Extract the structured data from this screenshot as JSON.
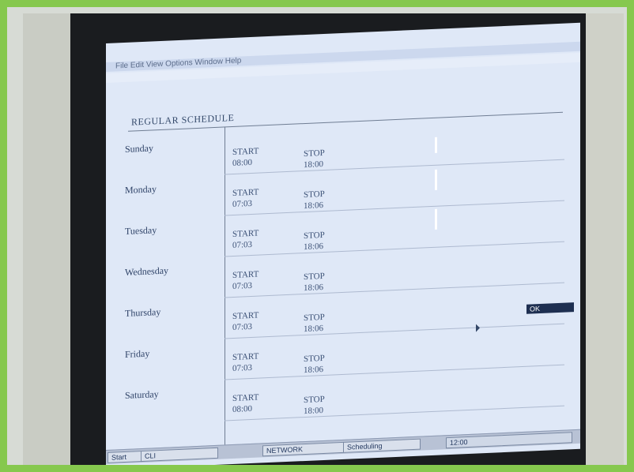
{
  "window": {
    "title": "REGULAR SCHEDULE",
    "menu_text": "File  Edit  View  Options  Window  Help"
  },
  "schedule": [
    {
      "day": "Sunday",
      "start_label": "START",
      "start": "08:00",
      "stop_label": "STOP",
      "stop": "18:00"
    },
    {
      "day": "Monday",
      "start_label": "START",
      "start": "07:03",
      "stop_label": "STOP",
      "stop": "18:06"
    },
    {
      "day": "Tuesday",
      "start_label": "START",
      "start": "07:03",
      "stop_label": "STOP",
      "stop": "18:06"
    },
    {
      "day": "Wednesday",
      "start_label": "START",
      "start": "07:03",
      "stop_label": "STOP",
      "stop": "18:06"
    },
    {
      "day": "Thursday",
      "start_label": "START",
      "start": "07:03",
      "stop_label": "STOP",
      "stop": "18:06"
    },
    {
      "day": "Friday",
      "start_label": "START",
      "start": "07:03",
      "stop_label": "STOP",
      "stop": "18:06"
    },
    {
      "day": "Saturday",
      "start_label": "START",
      "start": "08:00",
      "stop_label": "STOP",
      "stop": "18:00"
    }
  ],
  "taskbar": {
    "start_label": "Start",
    "t1_label": "CLI",
    "t2_label": "NETWORK",
    "t3_label": "Scheduling",
    "clock_label": "12:00"
  },
  "selection_text": "OK"
}
